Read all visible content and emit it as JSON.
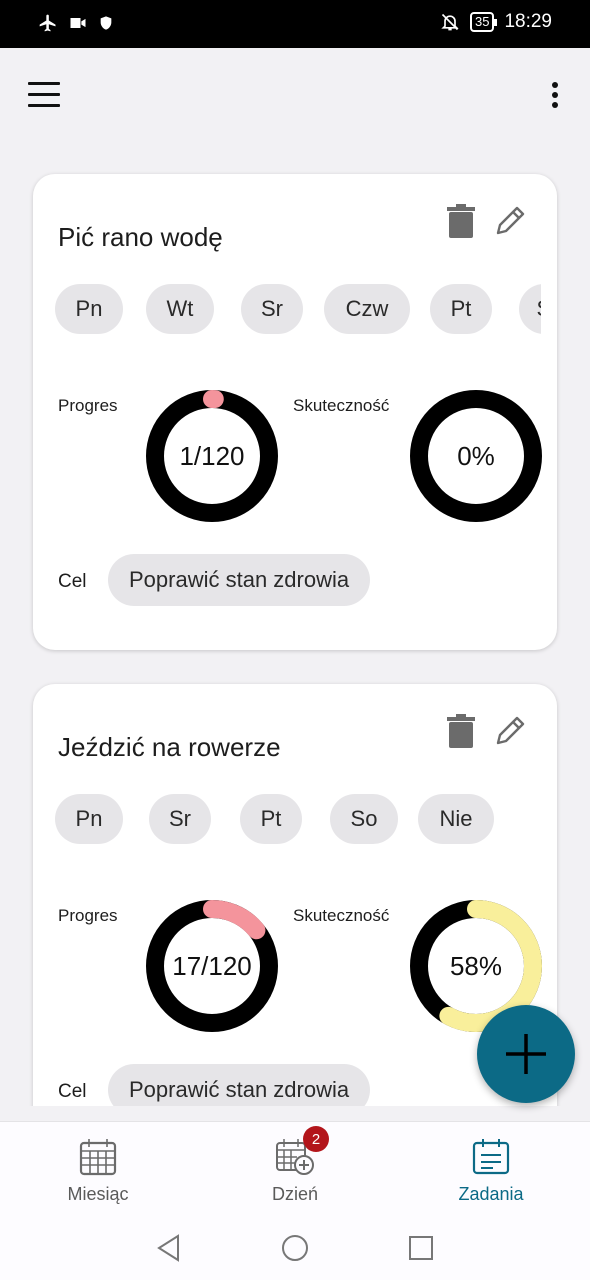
{
  "status_bar": {
    "time": "18:29",
    "battery": "35"
  },
  "app_bar": {
    "menu_icon": "menu-icon",
    "more_icon": "more-vertical-icon"
  },
  "tasks": [
    {
      "title": "Pić rano wodę",
      "days": [
        "Pn",
        "Wt",
        "Sr",
        "Czw",
        "Pt",
        "So"
      ],
      "progress_label": "Progres",
      "progress_text": "1/120",
      "progress_fraction": 0.008,
      "effectiveness_label": "Skuteczność",
      "effectiveness_text": "0%",
      "effectiveness_fraction": 0.0,
      "goal_label": "Cel",
      "goal": "Poprawić stan zdrowia"
    },
    {
      "title": "Jeździć na rowerze",
      "days": [
        "Pn",
        "Sr",
        "Pt",
        "So",
        "Nie"
      ],
      "progress_label": "Progres",
      "progress_text": "17/120",
      "progress_fraction": 0.142,
      "effectiveness_label": "Skuteczność",
      "effectiveness_text": "58%",
      "effectiveness_fraction": 0.58,
      "goal_label": "Cel",
      "goal": "Poprawić stan zdrowia"
    }
  ],
  "bottom_nav": [
    {
      "label": "Miesiąc",
      "icon": "calendar-month-icon",
      "active": false
    },
    {
      "label": "Dzień",
      "icon": "calendar-add-icon",
      "active": false,
      "badge": "2"
    },
    {
      "label": "Zadania",
      "icon": "task-list-icon",
      "active": true
    }
  ],
  "colors": {
    "accent": "#0c6a86",
    "progress": "#f4949c",
    "effectiveness": "#f9ef9b",
    "ring_track": "#000000",
    "badge": "#b3151b"
  }
}
